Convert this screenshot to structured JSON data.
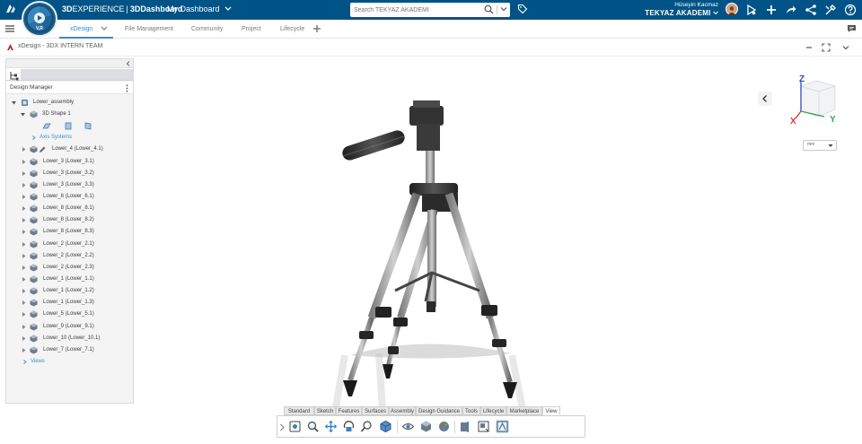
{
  "topbar": {
    "brand_3d": "3D",
    "brand_experience": "EXPERIENCE",
    "brand_separator": "|",
    "brand_app": "3DDashboard",
    "dashboard_name": "My Dashboard",
    "compass_label": "V,R",
    "search_placeholder": "Search TEKYAZ AKADEMI",
    "user_name": "Hüseyin Kacmaz",
    "user_org": "TEKYAZ AKADEMI",
    "icons": [
      "share-icon",
      "plus-icon",
      "forward-icon",
      "network-share-icon",
      "tools-icon",
      "help-icon"
    ]
  },
  "tabs": {
    "items": [
      {
        "label": "xDesign",
        "active": true
      },
      {
        "label": "File Management",
        "active": false
      },
      {
        "label": "Community",
        "active": false
      },
      {
        "label": "Project",
        "active": false
      },
      {
        "label": "Lifecycle",
        "active": false
      }
    ]
  },
  "appbar": {
    "title": "xDesign - 3DX INTERN TEAM"
  },
  "design_manager": {
    "title": "Design Manager",
    "root": "Lower_assembly",
    "shape": "3D Shape 1",
    "axis_systems": "Axis Systems",
    "items": [
      "Lower_4 (Lower_4.1)",
      "Lower_3 (Lower_3.1)",
      "Lower_3 (Lower_3.2)",
      "Lower_3 (Lower_3.3)",
      "Lower_6 (Lower_6.1)",
      "Lower_8 (Lower_8.1)",
      "Lower_8 (Lower_8.2)",
      "Lower_8 (Lower_8.3)",
      "Lower_2 (Lower_2.1)",
      "Lower_2 (Lower_2.2)",
      "Lower_2 (Lower_2.3)",
      "Lower_1 (Lower_1.1)",
      "Lower_1 (Lower_1.2)",
      "Lower_1 (Lower_1.3)",
      "Lower_5 (Lower_5.1)",
      "Lower_9 (Lower_9.1)",
      "Lower_10 (Lower_10.1)",
      "Lower_7 (Lower_7.1)"
    ],
    "footer_item": "Views"
  },
  "viewport": {
    "triad": {
      "z": "Z",
      "x": "X",
      "y": "Y"
    },
    "unit": "mm"
  },
  "actionbar": {
    "tabs": [
      {
        "label": "Standard",
        "active": false
      },
      {
        "label": "Sketch",
        "active": false
      },
      {
        "label": "Features",
        "active": false
      },
      {
        "label": "Surfaces",
        "active": false
      },
      {
        "label": "Assembly",
        "active": false
      },
      {
        "label": "Design Guidance",
        "active": false
      },
      {
        "label": "Tools",
        "active": false
      },
      {
        "label": "Lifecycle",
        "active": false
      },
      {
        "label": "Marketplace",
        "active": false
      },
      {
        "label": "View",
        "active": true
      }
    ],
    "tools": [
      "fit-all-icon",
      "zoom-icon",
      "pan-icon",
      "rotate-icon",
      "zoom-area-icon",
      "view-cube-icon",
      "visibility-icon",
      "render-style-icon",
      "appearance-icon",
      "section-icon",
      "view-mode-icon",
      "compass-view-icon"
    ]
  },
  "colors": {
    "topbar": "#005386",
    "accent": "#368ec4"
  }
}
